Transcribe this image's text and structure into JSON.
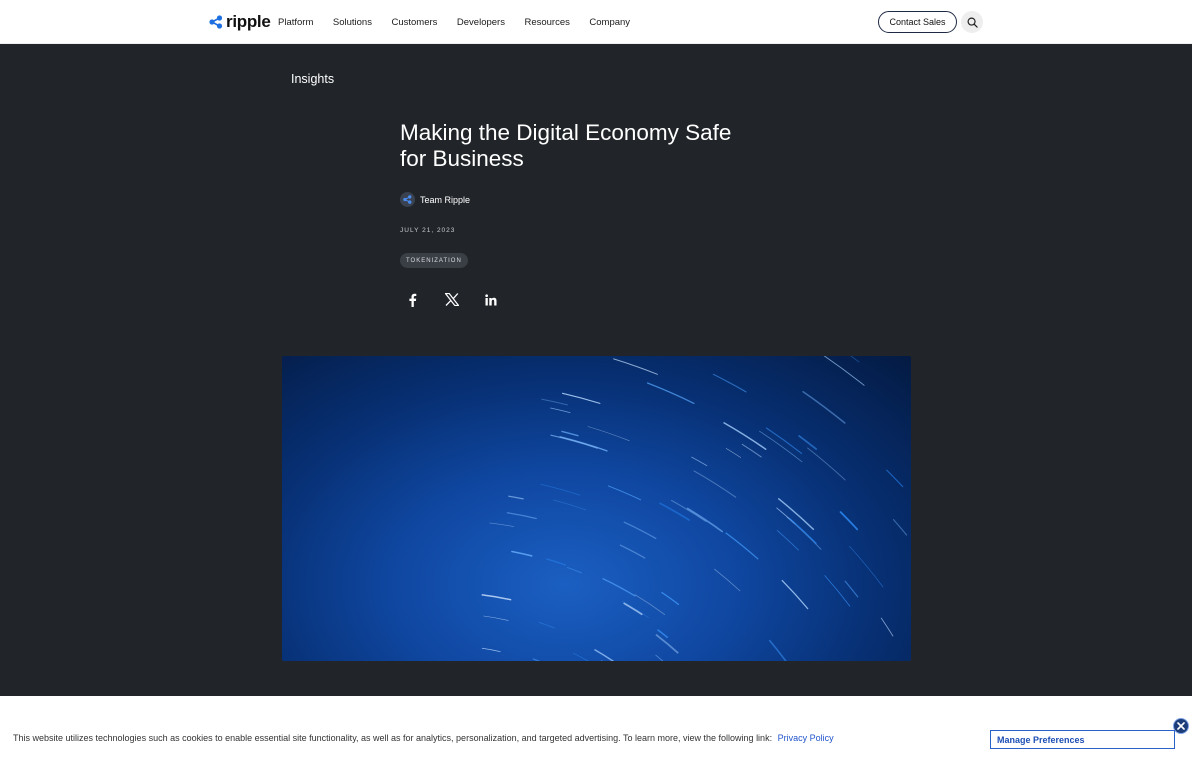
{
  "header": {
    "logo_text": "ripple",
    "nav": [
      {
        "label": "Platform"
      },
      {
        "label": "Solutions"
      },
      {
        "label": "Customers"
      },
      {
        "label": "Developers"
      },
      {
        "label": "Resources"
      },
      {
        "label": "Company"
      }
    ],
    "contact_label": "Contact Sales",
    "search_icon": "search-icon"
  },
  "article": {
    "section": "Insights",
    "title": "Making the Digital Economy Safe for Business",
    "author": "Team Ripple",
    "date": "JULY 21, 2023",
    "tag": "TOKENIZATION",
    "share": [
      {
        "icon": "facebook-icon"
      },
      {
        "icon": "x-icon"
      },
      {
        "icon": "linkedin-icon"
      }
    ],
    "hero_image": "blue star trails"
  },
  "cookie_banner": {
    "text": "This website utilizes technologies such as cookies to enable essential site functionality, as well as for analytics, personalization, and targeted advertising. To learn more, view the following link:",
    "link_label": "Privacy Policy",
    "manage_label": "Manage Preferences",
    "close_icon": "close-icon"
  },
  "colors": {
    "hero_bg": "#21252a",
    "accent": "#1d4fb5",
    "logo_blue": "#1e6fe0"
  }
}
